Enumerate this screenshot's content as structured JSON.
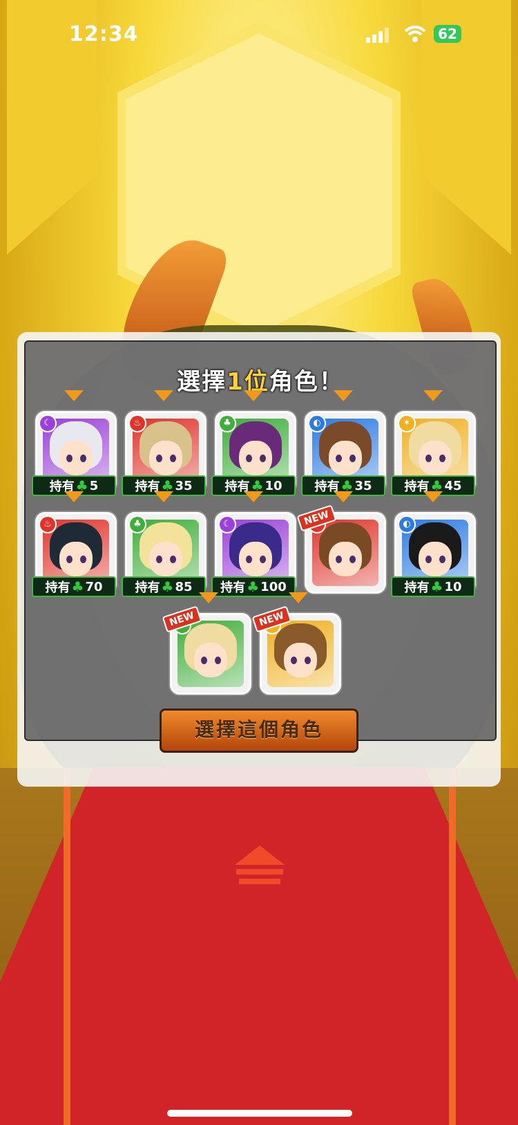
{
  "status_bar": {
    "time": "12:34",
    "battery": "62"
  },
  "dialog": {
    "title_before": "選擇",
    "title_highlight": "1位",
    "title_after": "角色！",
    "confirm_button": "選擇這個角色"
  },
  "own_label": "持有",
  "characters": [
    {
      "owned": "5",
      "element": "dark",
      "color": "#9b40d8"
    },
    {
      "owned": "35",
      "element": "fire",
      "color": "#e0342b"
    },
    {
      "owned": "10",
      "element": "wood",
      "color": "#3fae3a"
    },
    {
      "owned": "35",
      "element": "water",
      "color": "#2b7be3"
    },
    {
      "owned": "45",
      "element": "light",
      "color": "#f0b020"
    },
    {
      "owned": "70",
      "element": "fire",
      "color": "#e0342b"
    },
    {
      "owned": "85",
      "element": "wood",
      "color": "#3fae3a"
    },
    {
      "owned": "100",
      "element": "dark",
      "color": "#9b40d8"
    },
    {
      "badge": "NEW",
      "element": "fire",
      "color": "#e0342b"
    },
    {
      "owned": "10",
      "element": "water",
      "color": "#2b7be3"
    },
    {
      "badge": "NEW",
      "element": "wood",
      "color": "#3fae3a"
    },
    {
      "badge": "NEW",
      "element": "light",
      "color": "#f0b020"
    }
  ]
}
